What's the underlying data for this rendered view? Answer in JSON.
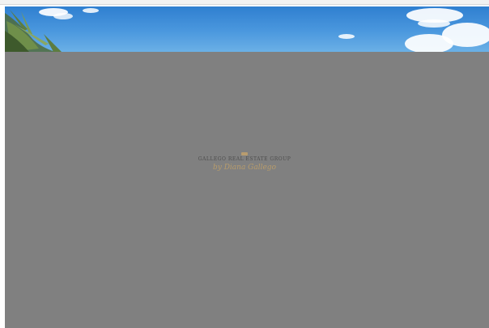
{
  "brand": {
    "title": "GALLEGO REAL ESTATE GROUP",
    "signature": "by Diana Gallego",
    "accent_color": "#c6a36a",
    "overlay_color": "#808080"
  }
}
